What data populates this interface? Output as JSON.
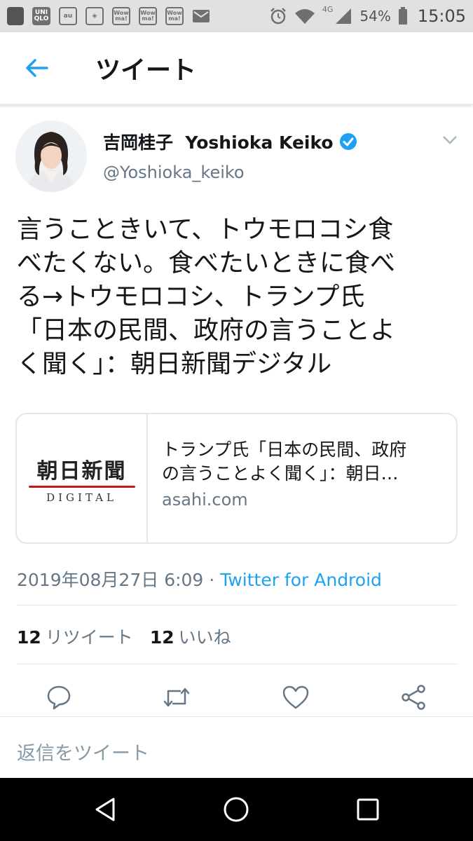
{
  "status_bar": {
    "notification_icons": [
      "UNI QLO",
      "au",
      "◈",
      "Wow ma!",
      "Wow ma!",
      "Wow ma!"
    ],
    "battery": "54%",
    "time": "15:05",
    "network": "4G"
  },
  "app_bar": {
    "title": "ツイート"
  },
  "tweet": {
    "display_name": "吉岡桂子  Yoshioka Keiko",
    "handle": "@Yoshioka_keiko",
    "body_lines": [
      "言うこときいて、トウモロコシ食",
      "べたくない。食べたいときに食べ",
      "る→トウモロコシ、トランプ氏",
      "「日本の民間、政府の言うことよ",
      "く聞く」：朝日新聞デジタル"
    ],
    "card": {
      "logo_main": "朝日新聞",
      "logo_sub": "DIGITAL",
      "title_lines": [
        "トランプ氏「日本の民間、政府",
        "の言うことよく聞く」：朝日…"
      ],
      "domain": "asahi.com"
    },
    "timestamp": "2019年08月27日 6:09 · ",
    "client": "Twitter for Android",
    "retweets": {
      "count": "12",
      "label": "リツイート"
    },
    "likes": {
      "count": "12",
      "label": "いいね"
    }
  },
  "reply": {
    "placeholder": "返信をツイート"
  },
  "colors": {
    "accent": "#1da1f2",
    "secondary_text": "#657786",
    "border": "#e1e8ed"
  }
}
